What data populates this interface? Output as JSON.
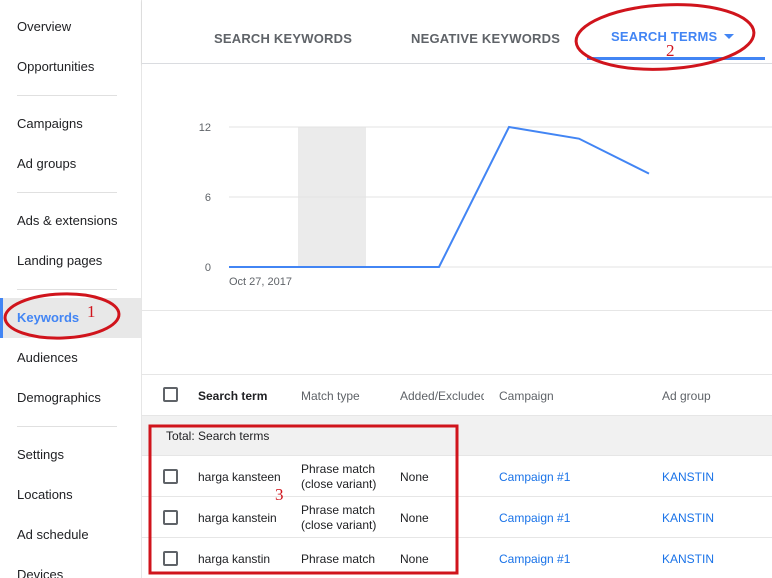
{
  "sidebar": {
    "items": [
      {
        "label": "Overview"
      },
      {
        "label": "Opportunities"
      },
      {
        "label": "Campaigns"
      },
      {
        "label": "Ad groups"
      },
      {
        "label": "Ads & extensions"
      },
      {
        "label": "Landing pages"
      },
      {
        "label": "Keywords",
        "active": true
      },
      {
        "label": "Audiences"
      },
      {
        "label": "Demographics"
      },
      {
        "label": "Settings"
      },
      {
        "label": "Locations"
      },
      {
        "label": "Ad schedule"
      },
      {
        "label": "Devices"
      }
    ]
  },
  "tabs": [
    {
      "label": "SEARCH KEYWORDS"
    },
    {
      "label": "NEGATIVE KEYWORDS"
    },
    {
      "label": "SEARCH TERMS",
      "active": true
    }
  ],
  "chart_data": {
    "type": "line",
    "title": "",
    "xlabel": "",
    "ylabel": "",
    "x_tick_labels": [
      "Oct 27, 2017"
    ],
    "y_ticks": [
      0,
      6,
      12
    ],
    "ylim": [
      0,
      12
    ],
    "series": [
      {
        "values": [
          0,
          0,
          0,
          0,
          12,
          11,
          8
        ],
        "color": "#4285f4"
      }
    ],
    "highlight_band": true,
    "grid": true
  },
  "table": {
    "columns": [
      "Search term",
      "Match type",
      "Added/Excluded",
      "Campaign",
      "Ad group"
    ],
    "total_label": "Total: Search terms",
    "rows": [
      {
        "term": "harga kansteen",
        "match1": "Phrase match",
        "match2": "(close variant)",
        "added": "None",
        "campaign": "Campaign #1",
        "adgroup": "KANSTIN"
      },
      {
        "term": "harga kanstein",
        "match1": "Phrase match",
        "match2": "(close variant)",
        "added": "None",
        "campaign": "Campaign #1",
        "adgroup": "KANSTIN"
      },
      {
        "term": "harga kanstin",
        "match1": "Phrase match",
        "match2": "",
        "added": "None",
        "campaign": "Campaign #1",
        "adgroup": "KANSTIN"
      }
    ]
  },
  "annotations": {
    "n1": "1",
    "n2": "2",
    "n3": "3",
    "color": "#d0141c"
  }
}
